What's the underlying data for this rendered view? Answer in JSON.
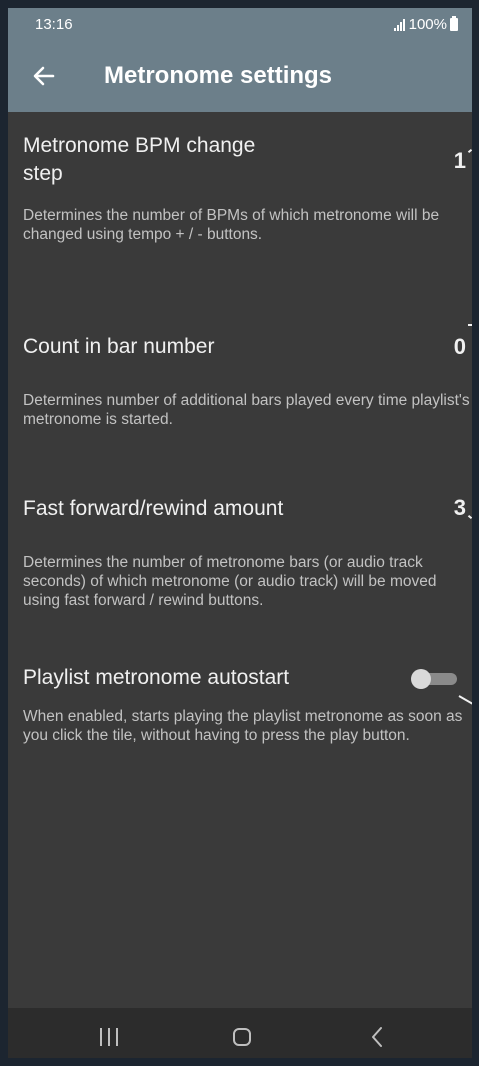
{
  "status_bar": {
    "time": "13:16",
    "battery": "100%",
    "icons": [
      "signal-icon",
      "battery-icon"
    ]
  },
  "app_bar": {
    "title": "Metronome settings",
    "back_icon": "arrow-left-icon"
  },
  "settings": [
    {
      "title_line1": "Metronome BPM change",
      "title_line2": "step",
      "value": "1",
      "description": "Determines the number of BPMs of which metronome will be changed using tempo + / - buttons."
    },
    {
      "title": "Count in bar number",
      "value": "0",
      "description": "Determines number of additional bars played every time playlist's metronome is started."
    },
    {
      "title": "Fast forward/rewind amount",
      "value": "3",
      "description": "Determines the number of metronome bars (or audio track seconds) of which metronome (or audio track) will be moved using fast forward / rewind buttons."
    },
    {
      "title": "Playlist metronome autostart",
      "toggle_on": false,
      "description": "When enabled, starts playing the playlist metronome as soon as you click the tile, without having to press the play button."
    }
  ],
  "nav_bar": {
    "icons": [
      "recent-apps-icon",
      "home-icon",
      "back-icon"
    ]
  },
  "colors": {
    "app_bar": "#6c7f8a",
    "background": "#3a3a3a",
    "nav_bar": "#2c2c2c",
    "frame": "#1c2530"
  }
}
